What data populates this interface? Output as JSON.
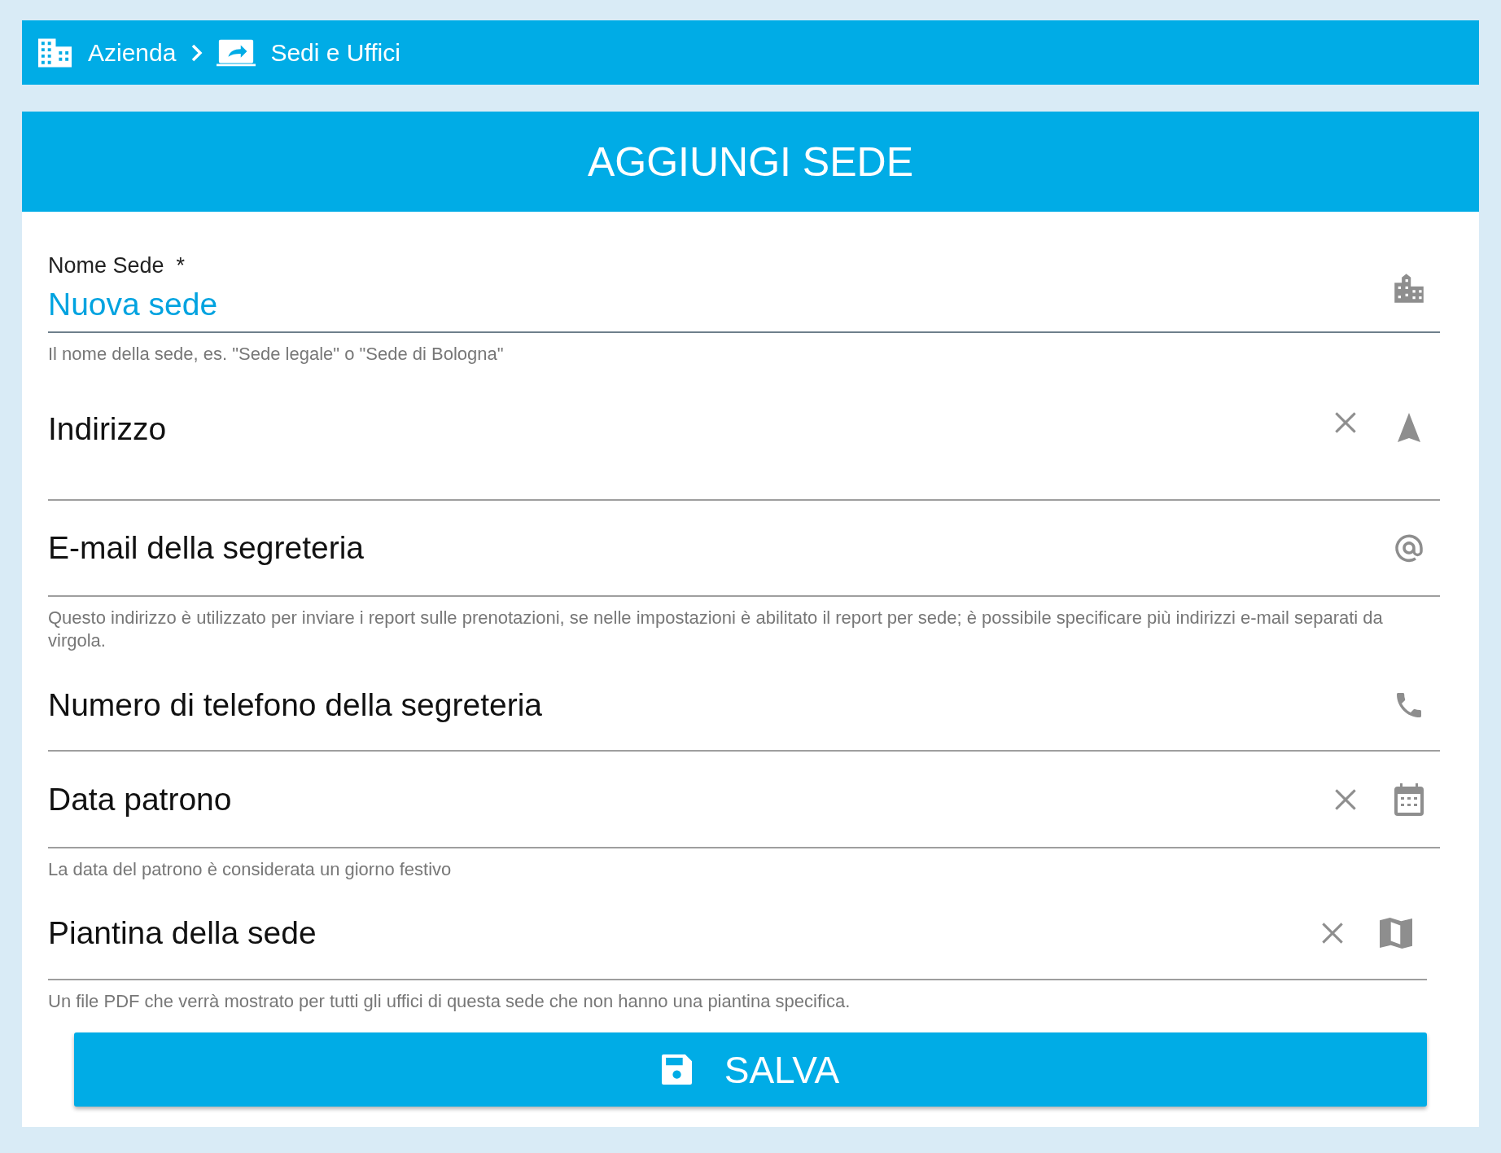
{
  "breadcrumb": [
    {
      "label": "Azienda"
    },
    {
      "label": "Sedi e Uffici"
    }
  ],
  "title": "AGGIUNGI SEDE",
  "fields": [
    {
      "label": "Nome Sede",
      "required_mark": "*",
      "value": "Nuova sede",
      "clearable": false,
      "helper": "Il nome della sede, es. \"Sede legale\" o \"Sede di Bologna\""
    },
    {
      "label": "Indirizzo",
      "clearable": true
    },
    {
      "label": "E-mail della segreteria",
      "clearable": false,
      "helper": "Questo indirizzo è utilizzato per inviare i report sulle prenotazioni, se nelle impostazioni è abilitato il report per sede; è possibile specificare più indirizzi e-mail separati da virgola."
    },
    {
      "label": "Numero di telefono della segreteria",
      "clearable": false
    },
    {
      "label": "Data patrono",
      "clearable": true,
      "helper": "La data del patrono è considerata un giorno festivo"
    },
    {
      "label": "Piantina della sede",
      "clearable": true,
      "helper": "Un file PDF che verrà mostrato per tutti gli uffici di questa sede che non hanno una piantina specifica."
    }
  ],
  "save_button": "SALVA"
}
